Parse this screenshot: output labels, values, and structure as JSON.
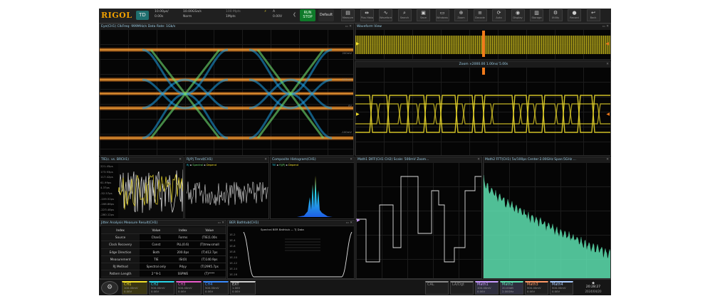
{
  "brand": "RIGOL",
  "mode": "TD",
  "toolbar": {
    "timebase_1": "10.00μs/",
    "timebase_2": "0.00s",
    "sample_1": "10.00GSa/s",
    "sample_2": "Norm",
    "memory_1": "100 Mpts",
    "memory_2": "1Mpts",
    "trig_val_1": "0.00V",
    "trig_ch": "A",
    "run_label_1": "RUN",
    "run_label_2": "STOP",
    "trigger_label": "Default",
    "buttons": [
      {
        "icon": "measure-icon",
        "glyph": "▤",
        "label": "Measure"
      },
      {
        "icon": "cursor-icon",
        "glyph": "⇹",
        "label": "Plus Histo"
      },
      {
        "icon": "waveform-icon",
        "glyph": "∿",
        "label": "Waveform"
      },
      {
        "icon": "search-icon",
        "glyph": "⌕",
        "label": "Search"
      },
      {
        "icon": "save-icon",
        "glyph": "▣",
        "label": "Save"
      },
      {
        "icon": "window-icon",
        "glyph": "▭",
        "label": "Windows"
      },
      {
        "icon": "zoom-icon",
        "glyph": "⊕",
        "label": "Zoom"
      },
      {
        "icon": "decode-icon",
        "glyph": "≡",
        "label": "Decode"
      },
      {
        "icon": "autoset-icon",
        "glyph": "⟳",
        "label": "Auto"
      },
      {
        "icon": "display-icon",
        "glyph": "◉",
        "label": "Display"
      },
      {
        "icon": "storage-icon",
        "glyph": "▥",
        "label": "Storage"
      },
      {
        "icon": "utility-icon",
        "glyph": "⚙",
        "label": "Utility"
      },
      {
        "icon": "record-icon",
        "glyph": "●",
        "label": "Record"
      },
      {
        "icon": "back-icon",
        "glyph": "↩",
        "label": "Back"
      }
    ]
  },
  "panels": {
    "eye": {
      "title": "Eye(CH1)   ClkFreq: 999MHz/s   Data   Rate: 1Gb/s",
      "ylabels": [
        "200mV",
        "100mV",
        "0V",
        "-100mV",
        "-200mV"
      ]
    },
    "waveview": {
      "title": "Waveform View",
      "right_label": "M"
    },
    "zoom": {
      "title": "Zoom ×2000.00  1.00ns/  5.00s"
    },
    "tie": {
      "title": "TIE(c. vs. BRCH1)",
      "ylabels": [
        "221.45ps",
        "173.93ps",
        "117.42ps",
        "61.99ps",
        "4.37ps",
        "-52.57ps",
        "-109.52ps",
        "-166.86ps",
        "-223.48ps",
        "-280.12ps"
      ]
    },
    "trend": {
      "title": "RJ/Pj  Trend(CH1)",
      "legend": [
        "RJ",
        "Spectral",
        "Depend"
      ]
    },
    "histo": {
      "title": "Composite  Histogram(CH1)",
      "legend": [
        "TIE",
        "RJ/Pj",
        "Depend"
      ]
    },
    "math1": {
      "title": "Math1  DIFF(CH1 CH2)  Scale: 500mV  Zoom..."
    },
    "fft": {
      "title": "Math2  FFT(CH1)  5x/100ps  Center:2.00GHz  Span:5GHz  ..."
    },
    "meas": {
      "title": "Jitter  Analysis  Measure  Result(CH1)",
      "headers": [
        "Index",
        "Value",
        "Index",
        "Value"
      ],
      "rows": [
        [
          "Source",
          "Chan1",
          "Forms",
          "(TIE)1.00s"
        ],
        [
          "Clock Recovery",
          "Const",
          "PLL(0.6)",
          "(T)tmw.small"
        ],
        [
          "Edge Direction",
          "Both",
          "200.0ps",
          "(T)412.7ps"
        ],
        [
          "Measurement",
          "TIE",
          "ISI(0)",
          "(T)140.9ps"
        ],
        [
          "RJ Method",
          "Spectral only",
          "Pdyy",
          "(T)2995.7ps"
        ],
        [
          "Pattern Length",
          "2^9-1",
          "SSPWE",
          "(T)****"
        ]
      ]
    },
    "ber": {
      "title": "BER  Bathtub(CH1)",
      "legend": [
        "Spectral BER Bathtub",
        "Tj Data"
      ],
      "ylabels": [
        "1E-2",
        "1E-4",
        "1E-6",
        "1E-8",
        "1E-10",
        "1E-12",
        "1E-14",
        "1E-16"
      ]
    }
  },
  "channels": [
    {
      "name": "CH1",
      "v1": "100.00mV",
      "v2": "0.00V",
      "color": "#f2e02a"
    },
    {
      "name": "CH2",
      "v1": "500.00mV",
      "v2": "0.00V",
      "color": "#27d4e8"
    },
    {
      "name": "CH3",
      "v1": "500.00mV",
      "v2": "0.00V",
      "color": "#e85acb"
    },
    {
      "name": "CH4",
      "v1": "500.00mV",
      "v2": "0.00V",
      "color": "#3a8cff"
    },
    {
      "name": "EXT",
      "v1": "1.00V",
      "v2": "0.00V",
      "color": "#cccccc"
    }
  ],
  "maths": [
    {
      "name": "CAL",
      "v1": "",
      "v2": "",
      "color": "#888888"
    },
    {
      "name": "LA/Dgt",
      "v1": "",
      "v2": "",
      "color": "#888888"
    },
    {
      "name": "Math1",
      "v1": "100.00mV",
      "v2": "0.00V",
      "color": "#c99cff"
    },
    {
      "name": "Math2",
      "v1": "20.00dB",
      "v2": "2.00GHz",
      "color": "#5ee0b0"
    },
    {
      "name": "Math3",
      "v1": "500.00mV",
      "v2": "0.00V",
      "color": "#ff9966"
    },
    {
      "name": "Math4",
      "v1": "500.00mV",
      "v2": "0.00V",
      "color": "#aaccff"
    }
  ],
  "clock": {
    "time": "20:28:27",
    "date": "2024/04/20"
  },
  "colors": {
    "ch1": "#f2e02a",
    "eye_orange": "#f07a1a",
    "eye_blue": "#1ea0e6",
    "fft": "#5ee0b0",
    "run": "#0f7a2a"
  }
}
